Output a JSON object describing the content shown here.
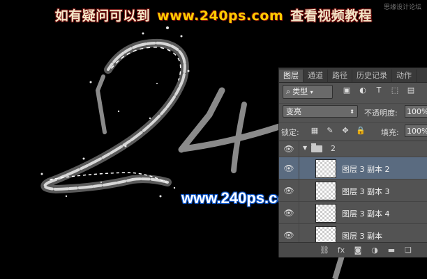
{
  "banner": {
    "text_left": "如有疑问可以到",
    "url": "www.240ps.com",
    "text_right": "查看视频教程",
    "small": "思缘设计论坛"
  },
  "watermark": "www.240ps.com",
  "panel": {
    "tabs": [
      "图层",
      "通道",
      "路径",
      "历史记录",
      "动作"
    ],
    "filter_label": "类型",
    "blend_mode": "变亮",
    "opacity_label": "不透明度:",
    "opacity_value": "100%",
    "lock_label": "锁定:",
    "fill_label": "填充:",
    "fill_value": "100%",
    "group_name": "2",
    "layers": [
      "图层 3 副本 2",
      "图层 3 副本 3",
      "图层 3 副本 4",
      "图层 3 副本"
    ],
    "selected_layer": 0
  },
  "icons": {
    "filter": "search-icon",
    "eye": "eye-icon",
    "folder": "folder-icon"
  },
  "colors": {
    "banner_red": "#6a0b0b",
    "banner_url": "#ffcc00",
    "watermark_glow": "#0a54c8",
    "selection": "#5a6b80"
  }
}
